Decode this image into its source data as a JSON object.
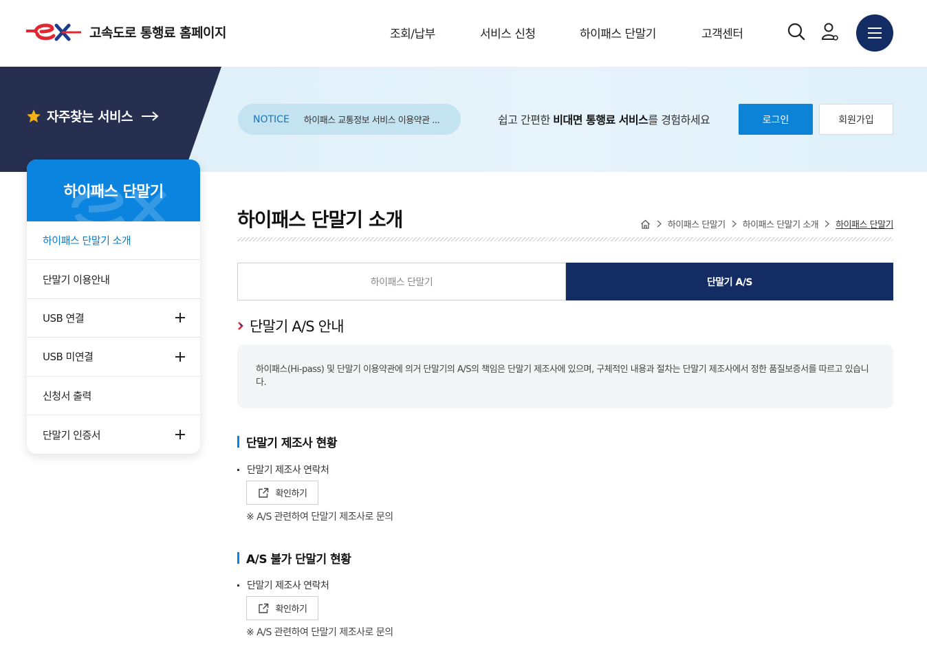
{
  "header": {
    "logo_text": "고속도로 통행료 홈페이지",
    "nav": [
      "조회/납부",
      "서비스 신청",
      "하이패스 단말기",
      "고객센터"
    ],
    "icons": [
      "search-icon",
      "user-icon",
      "menu-icon"
    ]
  },
  "banner": {
    "favorites_label": "자주찾는 서비스",
    "notice_tag": "NOTICE",
    "notice_text": "하이패스 교통정보 서비스 이용약관 ...",
    "promo_pre": "쉽고 간편한 ",
    "promo_bold": "비대면 통행료 서비스",
    "promo_post": "를 경험하세요",
    "login_label": "로그인",
    "join_label": "회원가입"
  },
  "sidebar": {
    "title": "하이패스 단말기",
    "items": [
      {
        "label": "하이패스 단말기 소개",
        "active": true,
        "expandable": false
      },
      {
        "label": "단말기 이용안내",
        "active": false,
        "expandable": false
      },
      {
        "label": "USB 연결",
        "active": false,
        "expandable": true
      },
      {
        "label": "USB 미연결",
        "active": false,
        "expandable": true
      },
      {
        "label": "신청서 출력",
        "active": false,
        "expandable": false
      },
      {
        "label": "단말기 인증서",
        "active": false,
        "expandable": true
      }
    ]
  },
  "content": {
    "page_title": "하이패스 단말기 소개",
    "breadcrumb": [
      "하이패스 단말기",
      "하이패스 단말기 소개",
      "하이패스 단말기"
    ],
    "tabs": [
      {
        "label": "하이패스 단말기",
        "active": false
      },
      {
        "label": "단말기 A/S",
        "active": true
      }
    ],
    "section_title": "단말기 A/S 안내",
    "info_text": "하이패스(Hi-pass) 및 단말기 이용약관에 의거 단말기의 A/S의 책임은 단말기 제조사에 있으며, 구체적인 내용과 절차는 단말기 제조사에서 정한 품질보증서를 따르고 있습니다.",
    "blocks": [
      {
        "title": "단말기 제조사 현황",
        "bullet": "단말기 제조사 연락처",
        "button": "확인하기",
        "note": "※ A/S 관련하여 단말기 제조사로 문의"
      },
      {
        "title": "A/S 불가 단말기 현황",
        "bullet": "단말기 제조사 연락처",
        "button": "확인하기",
        "note": "※ A/S 관련하여 단말기 제조사로 문의"
      }
    ]
  },
  "colors": {
    "navy": "#132c63",
    "blue": "#0a84de",
    "red": "#e3262f",
    "banner_bg": "#dbeef8",
    "favorites_bg": "#262f4f"
  }
}
